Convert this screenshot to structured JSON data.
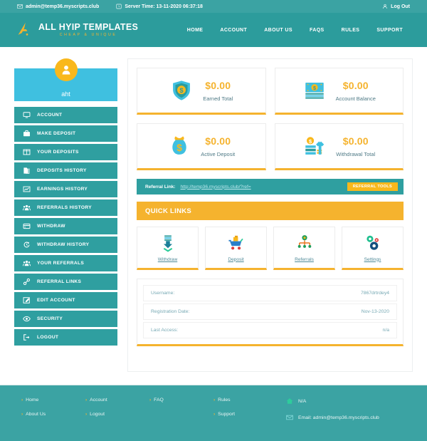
{
  "topbar": {
    "email": "admin@temp36.myscripts.club",
    "email_icon": "envelope-icon",
    "server_time": "Server Time: 13-11-2020 06:37:18",
    "clock_icon": "clock-icon",
    "logout_label": "Log Out",
    "logout_icon": "user-icon"
  },
  "header": {
    "logo_title": "ALL HYIP TEMPLATES",
    "logo_sub": "CHEAP & UNIQUE",
    "logo_icon": "triangle-a-logo-icon",
    "nav": [
      {
        "label": "HOME"
      },
      {
        "label": "ACCOUNT"
      },
      {
        "label": "ABOUT US"
      },
      {
        "label": "FAQS"
      },
      {
        "label": "RULES"
      },
      {
        "label": "SUPPORT"
      }
    ]
  },
  "sidebar": {
    "username": "aht",
    "avatar_icon": "user-avatar-icon",
    "items": [
      {
        "label": "ACCOUNT",
        "icon": "monitor-icon"
      },
      {
        "label": "MAKE DEPOSIT",
        "icon": "briefcase-icon"
      },
      {
        "label": "YOUR DEPOSITS",
        "icon": "columns-icon"
      },
      {
        "label": "DEPOSITS HISTORY",
        "icon": "documents-icon"
      },
      {
        "label": "EARNINGS HISTORY",
        "icon": "chart-line-icon"
      },
      {
        "label": "REFERRALS HISTORY",
        "icon": "users-icon"
      },
      {
        "label": "WITHDRAW",
        "icon": "credit-card-icon"
      },
      {
        "label": "WITHDRAW HISTORY",
        "icon": "history-icon"
      },
      {
        "label": "YOUR REFERRALS",
        "icon": "users-icon"
      },
      {
        "label": "REFERRAL LINKS",
        "icon": "link-icon"
      },
      {
        "label": "EDIT ACCOUNT",
        "icon": "edit-square-icon"
      },
      {
        "label": "SECURITY",
        "icon": "eye-icon"
      },
      {
        "label": "LOGOUT",
        "icon": "sign-out-icon"
      }
    ]
  },
  "stats": [
    {
      "value": "$0.00",
      "label": "Earned Total",
      "icon": "shield-dollar-icon"
    },
    {
      "value": "$0.00",
      "label": "Account Balance",
      "icon": "banknotes-icon"
    },
    {
      "value": "$0.00",
      "label": "Active Deposit",
      "icon": "money-bag-icon"
    },
    {
      "value": "$0.00",
      "label": "Withdrawal Total",
      "icon": "coins-up-arrow-icon"
    }
  ],
  "referral": {
    "label": "Referral Link:",
    "url": "http://temp36.myscripts.club/?ref=",
    "button_label": "REFERRAL TOOLS"
  },
  "quick_links": {
    "title": "QUICK LINKS",
    "items": [
      {
        "label": "Withdraw",
        "icon": "download-arrow-icon"
      },
      {
        "label": "Deposit",
        "icon": "shopping-cart-icon"
      },
      {
        "label": "Referrals",
        "icon": "network-tree-icon"
      },
      {
        "label": "Settings",
        "icon": "gears-icon"
      }
    ]
  },
  "info": {
    "rows": [
      {
        "label": "Username:",
        "value": "7867drtrdey4"
      },
      {
        "label": "Registration Date:",
        "value": "Nov-13-2020"
      },
      {
        "label": "Last Access:",
        "value": "n/a"
      }
    ]
  },
  "footer": {
    "col1": [
      {
        "label": "Home"
      },
      {
        "label": "About Us"
      }
    ],
    "col2": [
      {
        "label": "Account"
      },
      {
        "label": "Logout"
      }
    ],
    "col3": [
      {
        "label": "FAQ"
      }
    ],
    "col4": [
      {
        "label": "Rules"
      },
      {
        "label": "Support"
      }
    ],
    "contact": {
      "address": "N/A",
      "address_icon": "home-icon",
      "email": "Email: admin@temp36.myscripts.club",
      "email_icon": "envelope-icon"
    }
  },
  "colors": {
    "teal_dark": "#2c9c9c",
    "teal_bar": "#3ba3a3",
    "teal_menu": "#2f9fa0",
    "blue_light": "#3fc0e0",
    "orange": "#f5b32e",
    "orange_accent": "#f9b81c"
  }
}
